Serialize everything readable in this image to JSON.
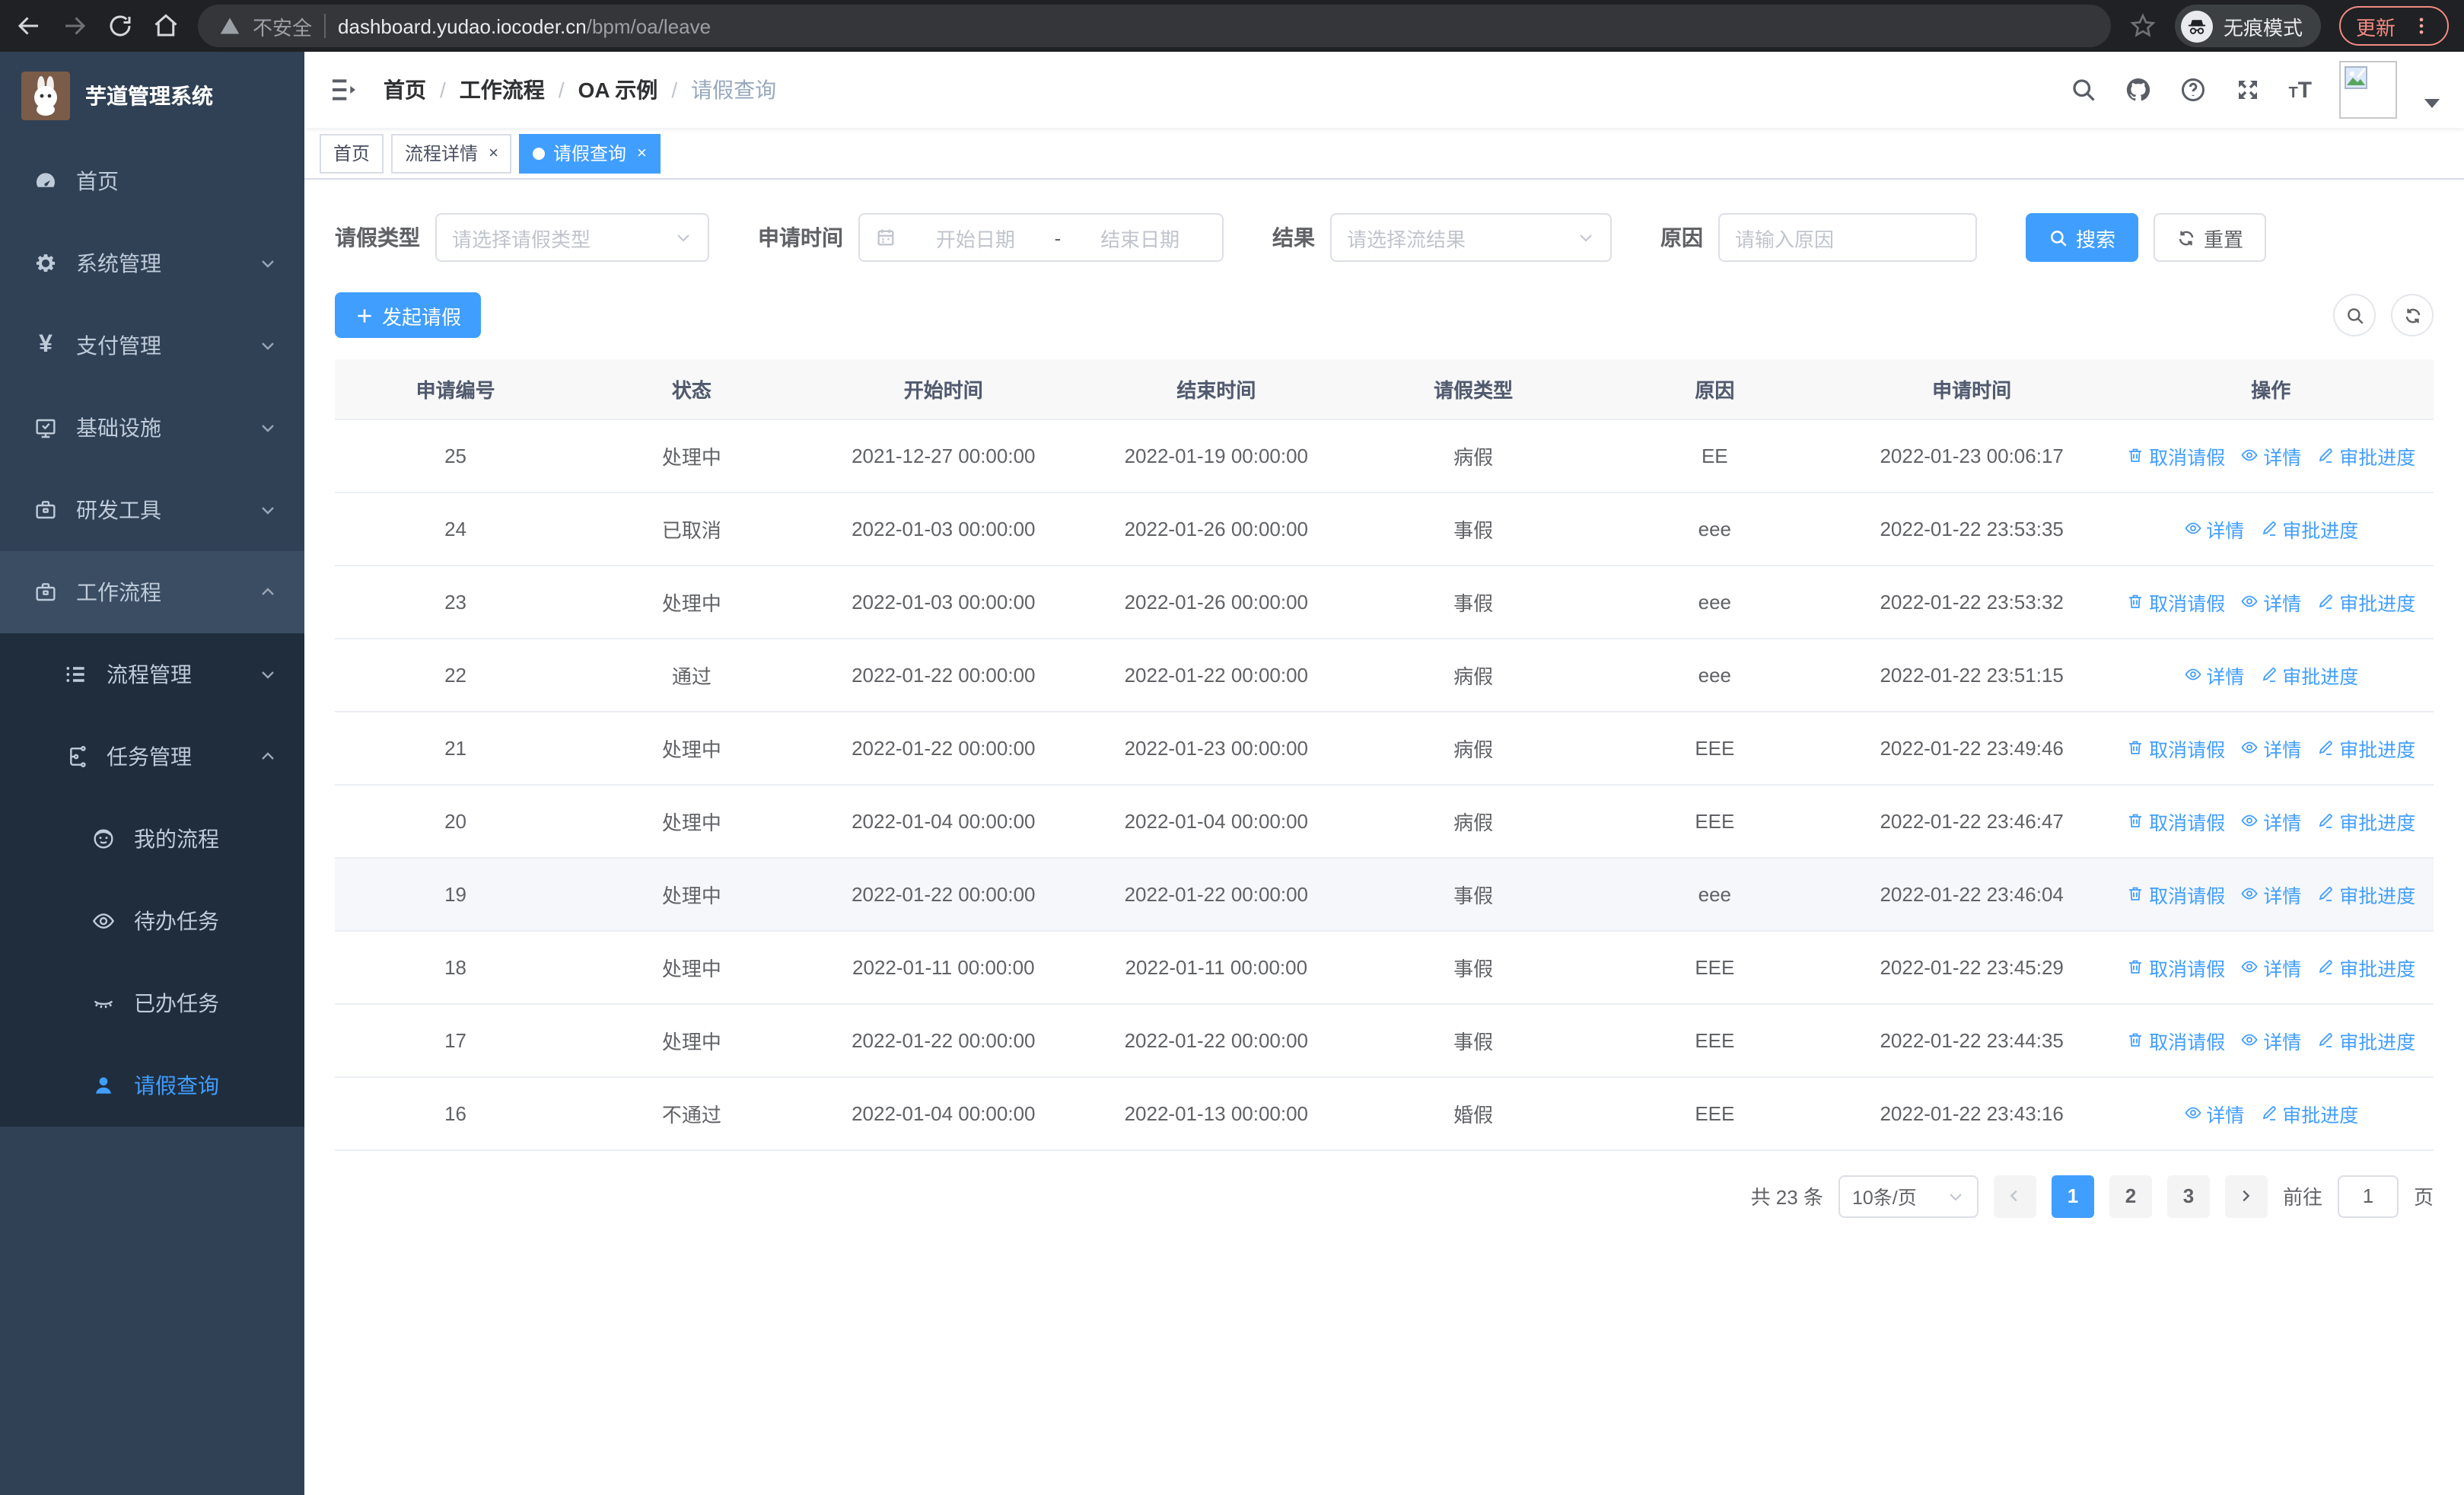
{
  "browser": {
    "security_label": "不安全",
    "url_host": "dashboard.yudao.iocoder.cn",
    "url_path": "/bpm/oa/leave",
    "incognito_label": "无痕模式",
    "update_label": "更新"
  },
  "app": {
    "title": "芋道管理系统"
  },
  "sidebar": {
    "items": [
      {
        "label": "首页",
        "icon": "dashboard-icon",
        "level": 1,
        "arrow": "",
        "group": "",
        "active": false
      },
      {
        "label": "系统管理",
        "icon": "gear-icon",
        "level": 1,
        "arrow": "down",
        "group": "",
        "active": false
      },
      {
        "label": "支付管理",
        "icon": "yen-icon",
        "level": 1,
        "arrow": "down",
        "group": "",
        "active": false
      },
      {
        "label": "基础设施",
        "icon": "monitor-icon",
        "level": 1,
        "arrow": "down",
        "group": "",
        "active": false
      },
      {
        "label": "研发工具",
        "icon": "toolbox-icon",
        "level": 1,
        "arrow": "down",
        "group": "",
        "active": false
      },
      {
        "label": "工作流程",
        "icon": "briefcase-icon",
        "level": 1,
        "arrow": "up",
        "group": "open-parent",
        "active": false
      },
      {
        "label": "流程管理",
        "icon": "list-icon",
        "level": 2,
        "arrow": "down",
        "group": "sub",
        "active": false
      },
      {
        "label": "任务管理",
        "icon": "tree-icon",
        "level": 2,
        "arrow": "up",
        "group": "sub",
        "active": false
      },
      {
        "label": "我的流程",
        "icon": "face-icon",
        "level": 3,
        "arrow": "",
        "group": "sub",
        "active": false
      },
      {
        "label": "待办任务",
        "icon": "eye-open-icon",
        "level": 3,
        "arrow": "",
        "group": "sub",
        "active": false
      },
      {
        "label": "已办任务",
        "icon": "eye-closed-icon",
        "level": 3,
        "arrow": "",
        "group": "sub",
        "active": false
      },
      {
        "label": "请假查询",
        "icon": "user-icon",
        "level": 3,
        "arrow": "",
        "group": "sub",
        "active": true
      }
    ]
  },
  "breadcrumb": {
    "items": [
      "首页",
      "工作流程",
      "OA 示例",
      "请假查询"
    ]
  },
  "tabs": {
    "items": [
      {
        "label": "首页",
        "closable": false,
        "active": false
      },
      {
        "label": "流程详情",
        "closable": true,
        "active": false
      },
      {
        "label": "请假查询",
        "closable": true,
        "active": true
      }
    ]
  },
  "filters": {
    "leave_type_label": "请假类型",
    "leave_type_placeholder": "请选择请假类型",
    "apply_time_label": "申请时间",
    "date_start_placeholder": "开始日期",
    "date_separator": "-",
    "date_end_placeholder": "结束日期",
    "result_label": "结果",
    "result_placeholder": "请选择流结果",
    "reason_label": "原因",
    "reason_placeholder": "请输入原因",
    "search_label": "搜索",
    "reset_label": "重置"
  },
  "toolbar": {
    "create_label": "发起请假"
  },
  "table": {
    "columns": [
      "申请编号",
      "状态",
      "开始时间",
      "结束时间",
      "请假类型",
      "原因",
      "申请时间",
      "操作"
    ],
    "rows": [
      {
        "id": "25",
        "status": "处理中",
        "start": "2021-12-27 00:00:00",
        "end": "2022-01-19 00:00:00",
        "type": "病假",
        "reason": "EE",
        "apply": "2022-01-23 00:06:17",
        "actions": [
          "cancel",
          "detail",
          "progress"
        ],
        "highlight": false
      },
      {
        "id": "24",
        "status": "已取消",
        "start": "2022-01-03 00:00:00",
        "end": "2022-01-26 00:00:00",
        "type": "事假",
        "reason": "eee",
        "apply": "2022-01-22 23:53:35",
        "actions": [
          "detail",
          "progress"
        ],
        "highlight": false
      },
      {
        "id": "23",
        "status": "处理中",
        "start": "2022-01-03 00:00:00",
        "end": "2022-01-26 00:00:00",
        "type": "事假",
        "reason": "eee",
        "apply": "2022-01-22 23:53:32",
        "actions": [
          "cancel",
          "detail",
          "progress"
        ],
        "highlight": false
      },
      {
        "id": "22",
        "status": "通过",
        "start": "2022-01-22 00:00:00",
        "end": "2022-01-22 00:00:00",
        "type": "病假",
        "reason": "eee",
        "apply": "2022-01-22 23:51:15",
        "actions": [
          "detail",
          "progress"
        ],
        "highlight": false
      },
      {
        "id": "21",
        "status": "处理中",
        "start": "2022-01-22 00:00:00",
        "end": "2022-01-23 00:00:00",
        "type": "病假",
        "reason": "EEE",
        "apply": "2022-01-22 23:49:46",
        "actions": [
          "cancel",
          "detail",
          "progress"
        ],
        "highlight": false
      },
      {
        "id": "20",
        "status": "处理中",
        "start": "2022-01-04 00:00:00",
        "end": "2022-01-04 00:00:00",
        "type": "病假",
        "reason": "EEE",
        "apply": "2022-01-22 23:46:47",
        "actions": [
          "cancel",
          "detail",
          "progress"
        ],
        "highlight": false
      },
      {
        "id": "19",
        "status": "处理中",
        "start": "2022-01-22 00:00:00",
        "end": "2022-01-22 00:00:00",
        "type": "事假",
        "reason": "eee",
        "apply": "2022-01-22 23:46:04",
        "actions": [
          "cancel",
          "detail",
          "progress"
        ],
        "highlight": true
      },
      {
        "id": "18",
        "status": "处理中",
        "start": "2022-01-11 00:00:00",
        "end": "2022-01-11 00:00:00",
        "type": "事假",
        "reason": "EEE",
        "apply": "2022-01-22 23:45:29",
        "actions": [
          "cancel",
          "detail",
          "progress"
        ],
        "highlight": false
      },
      {
        "id": "17",
        "status": "处理中",
        "start": "2022-01-22 00:00:00",
        "end": "2022-01-22 00:00:00",
        "type": "事假",
        "reason": "EEE",
        "apply": "2022-01-22 23:44:35",
        "actions": [
          "cancel",
          "detail",
          "progress"
        ],
        "highlight": false
      },
      {
        "id": "16",
        "status": "不通过",
        "start": "2022-01-04 00:00:00",
        "end": "2022-01-13 00:00:00",
        "type": "婚假",
        "reason": "EEE",
        "apply": "2022-01-22 23:43:16",
        "actions": [
          "detail",
          "progress"
        ],
        "highlight": false
      }
    ]
  },
  "actions": {
    "cancel": "取消请假",
    "detail": "详情",
    "progress": "审批进度"
  },
  "pagination": {
    "total_label": "共 23 条",
    "page_size_label": "10条/页",
    "pages": [
      "1",
      "2",
      "3"
    ],
    "active_page": "1",
    "goto_label": "前往",
    "goto_value": "1",
    "goto_suffix": "页"
  },
  "colors": {
    "accent": "#409eff",
    "sidebar_bg": "#304156",
    "sidebar_sub_bg": "#1f2d3d",
    "browser_bg": "#202124",
    "update_accent": "#f28b82"
  }
}
